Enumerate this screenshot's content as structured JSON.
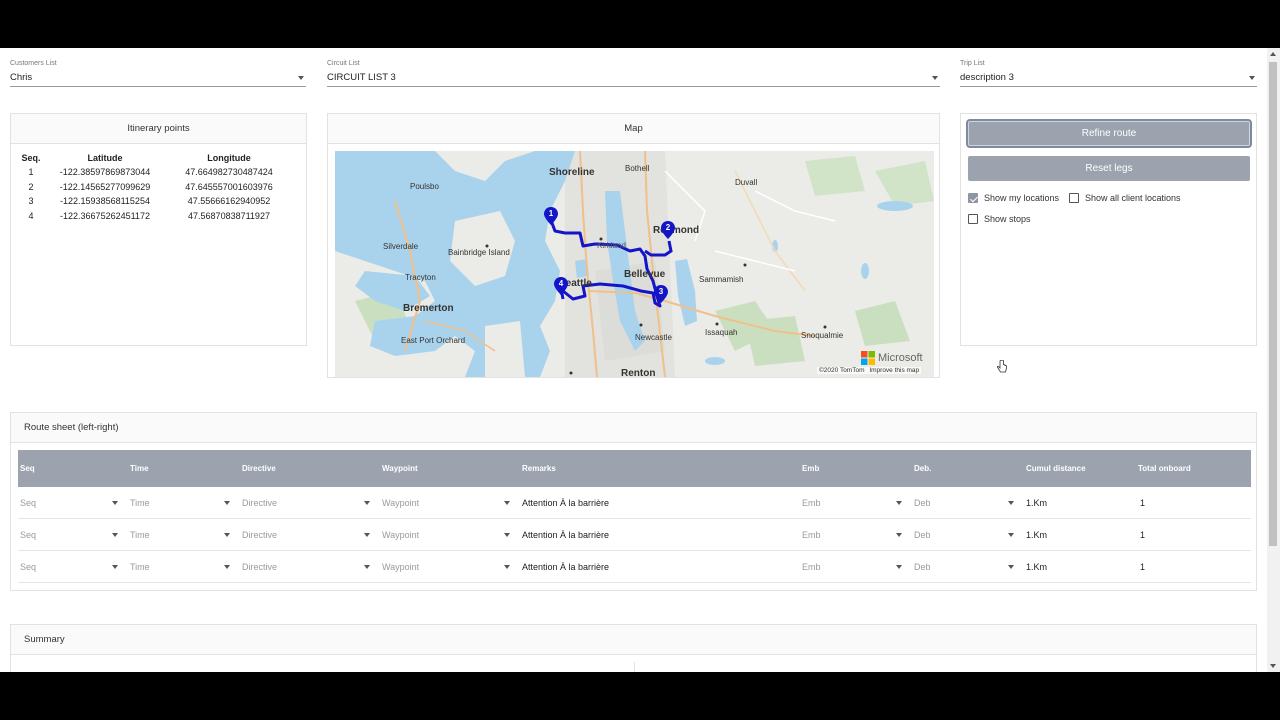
{
  "selectors": {
    "customers": {
      "label": "Customers List",
      "value": "Chris"
    },
    "circuit": {
      "label": "Circuit List",
      "value": "CIRCUIT LIST 3"
    },
    "trip": {
      "label": "Trip List",
      "value": "description 3"
    }
  },
  "itinerary": {
    "title": "Itinerary points",
    "headers": {
      "seq": "Seq.",
      "lat": "Latitude",
      "lon": "Longitude"
    },
    "rows": [
      {
        "seq": "1",
        "lat": "-122.38597869873044",
        "lon": "47.664982730487424"
      },
      {
        "seq": "2",
        "lat": "-122.14565277099629",
        "lon": "47.645557001603976"
      },
      {
        "seq": "3",
        "lat": "-122.15938568115254",
        "lon": "47.55666162940952"
      },
      {
        "seq": "4",
        "lat": "-122.36675262451172",
        "lon": "47.56870838711927"
      }
    ]
  },
  "map": {
    "title": "Map",
    "places": {
      "shoreline": "Shoreline",
      "bothell": "Bothell",
      "duvall": "Duvall",
      "poulsbo": "Poulsbo",
      "redmond": "Redmond",
      "silverdale": "Silverdale",
      "bainbridge": "Bainbridge Island",
      "kirkland": "Kirkland",
      "tracyton": "Tracyton",
      "seattle": "Seattle",
      "bellevue": "Bellevue",
      "sammamish": "Sammamish",
      "bremerton": "Bremerton",
      "issaquah": "Issaquah",
      "snoqualmie": "Snoqualmie",
      "eastport": "East Port Orchard",
      "newcastle": "Newcastle",
      "renton": "Renton"
    },
    "pins": [
      "1",
      "2",
      "3",
      "4"
    ],
    "brand": "Microsoft",
    "attribution": "©2020 TomTom",
    "improve": "Improve this map",
    "route_color": "#1414c8"
  },
  "actions": {
    "refine": "Refine route",
    "reset": "Reset legs",
    "show_my_locations": "Show my locations",
    "show_all_client_locations": "Show all client locations",
    "show_stops": "Show stops",
    "show_my_locations_checked": true,
    "show_all_client_locations_checked": false,
    "show_stops_checked": false
  },
  "route_sheet": {
    "title": "Route sheet (left-right)",
    "headers": {
      "seq": "Seq",
      "time": "Time",
      "directive": "Directive",
      "waypoint": "Waypoint",
      "remarks": "Remarks",
      "emb": "Emb",
      "deb": "Deb.",
      "cumul": "Cumul distance",
      "onboard": "Total onboard"
    },
    "rows": [
      {
        "seq": "Seq",
        "time": "Time",
        "directive": "Directive",
        "waypoint": "Waypoint",
        "remarks": "Attention À la barrière",
        "emb": "Emb",
        "deb": "Deb",
        "cumul": "1.Km",
        "onboard": "1"
      },
      {
        "seq": "Seq",
        "time": "Time",
        "directive": "Directive",
        "waypoint": "Waypoint",
        "remarks": "Attention À la barrière",
        "emb": "Emb",
        "deb": "Deb",
        "cumul": "1.Km",
        "onboard": "1"
      },
      {
        "seq": "Seq",
        "time": "Time",
        "directive": "Directive",
        "waypoint": "Waypoint",
        "remarks": "Attention À la barrière",
        "emb": "Emb",
        "deb": "Deb",
        "cumul": "1.Km",
        "onboard": "1"
      }
    ]
  },
  "summary": {
    "title": "Summary"
  }
}
